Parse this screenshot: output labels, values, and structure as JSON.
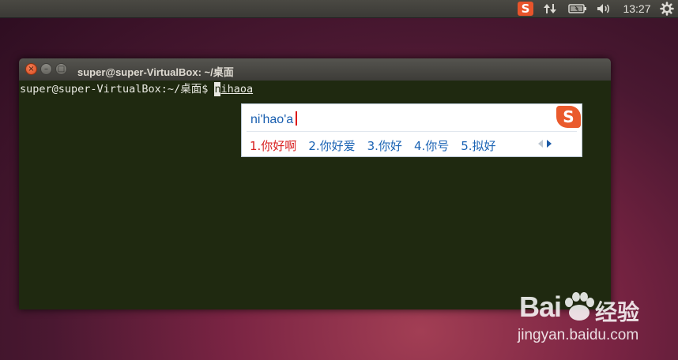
{
  "panel": {
    "tray_sogou_label": "S",
    "clock": "13:27"
  },
  "window": {
    "title": "super@super-VirtualBox: ~/桌面",
    "close_glyph": "×",
    "minimize_glyph": "–",
    "maximize_glyph": "□"
  },
  "terminal": {
    "prompt": "super@super-VirtualBox:~/桌面$ ",
    "preedit_first": "n",
    "preedit_rest": "ihaoa"
  },
  "ime": {
    "pinyin": "ni'hao'a",
    "logo": "S",
    "candidates": [
      "1.你好啊",
      "2.你好爱",
      "3.你好",
      "4.你号",
      "5.拟好"
    ]
  },
  "watermark": {
    "brand_left": "Bai",
    "brand_right": "经验",
    "url": "jingyan.baidu.com"
  },
  "icons": {
    "tray": [
      "sogou-input-icon",
      "network-updown-icon",
      "battery-icon",
      "volume-icon",
      "gear-icon"
    ],
    "window": [
      "close-icon",
      "minimize-icon",
      "maximize-icon"
    ]
  },
  "colors": {
    "terminal_bg": "#1f2910",
    "candidate_selected": "#d81e1e",
    "candidate_normal": "#1a63b4",
    "sogou_orange": "#ea5a2c"
  }
}
